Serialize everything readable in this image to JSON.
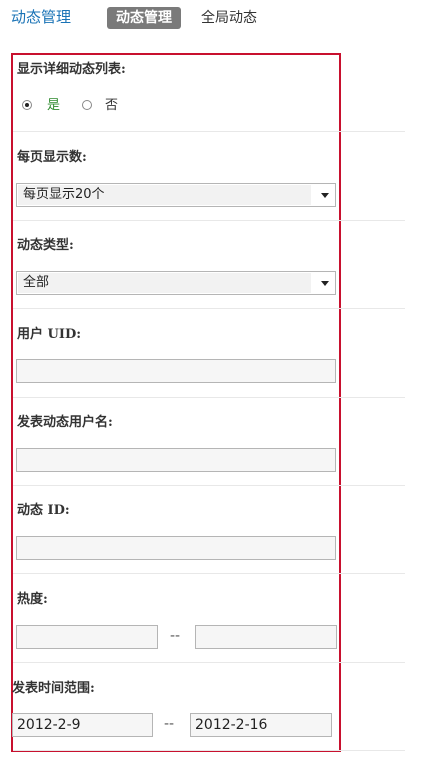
{
  "header": {
    "title": "动态管理",
    "active_tab": "动态管理",
    "other_tab": "全局动态"
  },
  "form": {
    "show_detail": {
      "label": "显示详细动态列表:",
      "options": [
        "是",
        "否"
      ],
      "selected": "是"
    },
    "per_page": {
      "label": "每页显示数:",
      "value": "每页显示20个"
    },
    "feed_type": {
      "label": "动态类型:",
      "value": "全部"
    },
    "user_uid": {
      "label": "用户  UID:",
      "value": ""
    },
    "username": {
      "label": "发表动态用户名:",
      "value": ""
    },
    "feed_id": {
      "label": "动态  ID:",
      "value": ""
    },
    "hot": {
      "label": "热度:",
      "from": "",
      "to": "",
      "separator": "--"
    },
    "time_range": {
      "label": "发表时间范围:",
      "from": "2012-2-9",
      "to": "2012-2-16",
      "separator": "--"
    }
  },
  "colors": {
    "panel_border": "#c8102e",
    "title_blue": "#1a73b6",
    "tab_active_bg": "#7a7a7a",
    "radio_selected_text": "#2e8b2e"
  }
}
